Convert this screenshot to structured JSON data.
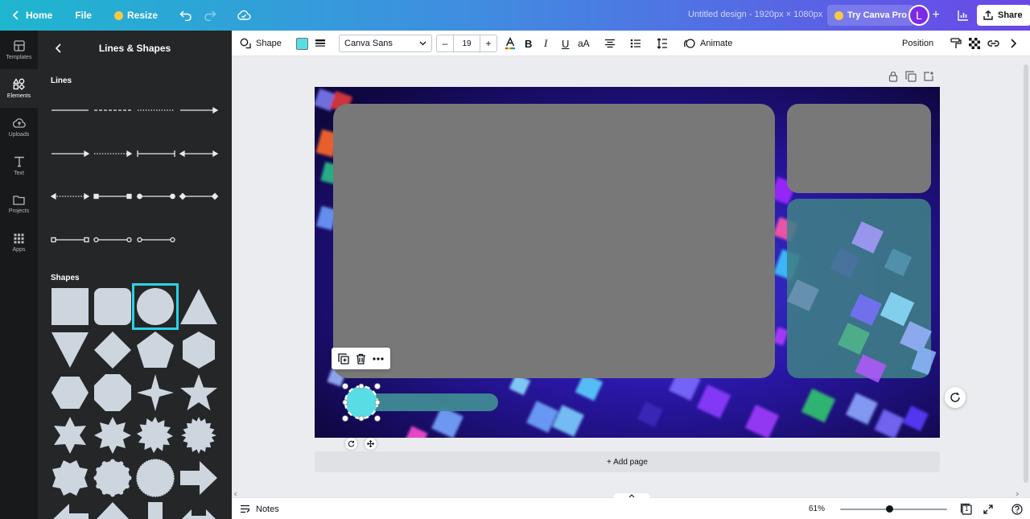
{
  "topbar": {
    "home_label": "Home",
    "file_label": "File",
    "resize_label": "Resize",
    "doc_title": "Untitled design - 1920px × 1080px",
    "try_pro_label": "Try Canva Pro",
    "avatar_initial": "L",
    "add_label": "+",
    "share_label": "Share",
    "gradient_colors": [
      "#1fb6cf",
      "#3f8ee0",
      "#6a47e8"
    ]
  },
  "rail": {
    "items": [
      {
        "label": "Templates",
        "icon": "templates-icon"
      },
      {
        "label": "Elements",
        "icon": "elements-icon"
      },
      {
        "label": "Uploads",
        "icon": "uploads-icon"
      },
      {
        "label": "Text",
        "icon": "text-icon"
      },
      {
        "label": "Projects",
        "icon": "projects-icon"
      },
      {
        "label": "Apps",
        "icon": "apps-icon"
      }
    ],
    "active": "Elements"
  },
  "panel": {
    "title": "Lines & Shapes",
    "lines_heading": "Lines",
    "shapes_heading": "Shapes",
    "shapes": [
      "square",
      "rounded-square",
      "circle",
      "triangle",
      "inverted-triangle",
      "diamond",
      "pentagon",
      "hexagon",
      "hexagon-flat",
      "octagon",
      "four-point-star",
      "five-point-star",
      "six-point-star",
      "eight-point-star",
      "twelve-point-burst",
      "sixteen-point-burst",
      "octagon-star",
      "scalloped-circle",
      "badge-circle",
      "right-arrow"
    ],
    "selected_shape": "circle",
    "shape_color": "#cdd5df",
    "selected_outline": "#2ad2e6"
  },
  "toolbar": {
    "shape_label": "Shape",
    "fill_color": "#57dde3",
    "font_name": "Canva Sans",
    "font_size": "19",
    "minus_label": "–",
    "plus_label": "+",
    "animate_label": "Animate",
    "position_label": "Position"
  },
  "canvas": {
    "add_page_label": "+ Add page",
    "highlight_color": "#57dde3"
  },
  "bottombar": {
    "notes_label": "Notes",
    "zoom_level": "61%",
    "page_count": "1"
  }
}
